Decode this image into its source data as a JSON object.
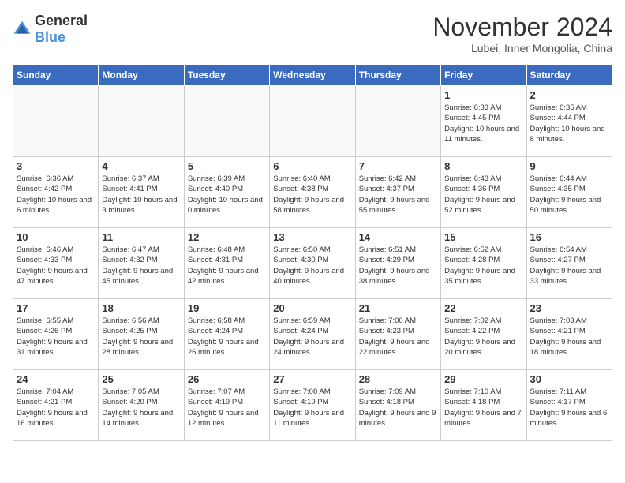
{
  "header": {
    "logo_general": "General",
    "logo_blue": "Blue",
    "month_title": "November 2024",
    "location": "Lubei, Inner Mongolia, China"
  },
  "weekdays": [
    "Sunday",
    "Monday",
    "Tuesday",
    "Wednesday",
    "Thursday",
    "Friday",
    "Saturday"
  ],
  "weeks": [
    [
      {
        "day": "",
        "info": ""
      },
      {
        "day": "",
        "info": ""
      },
      {
        "day": "",
        "info": ""
      },
      {
        "day": "",
        "info": ""
      },
      {
        "day": "",
        "info": ""
      },
      {
        "day": "1",
        "info": "Sunrise: 6:33 AM\nSunset: 4:45 PM\nDaylight: 10 hours and 11 minutes."
      },
      {
        "day": "2",
        "info": "Sunrise: 6:35 AM\nSunset: 4:44 PM\nDaylight: 10 hours and 8 minutes."
      }
    ],
    [
      {
        "day": "3",
        "info": "Sunrise: 6:36 AM\nSunset: 4:42 PM\nDaylight: 10 hours and 6 minutes."
      },
      {
        "day": "4",
        "info": "Sunrise: 6:37 AM\nSunset: 4:41 PM\nDaylight: 10 hours and 3 minutes."
      },
      {
        "day": "5",
        "info": "Sunrise: 6:39 AM\nSunset: 4:40 PM\nDaylight: 10 hours and 0 minutes."
      },
      {
        "day": "6",
        "info": "Sunrise: 6:40 AM\nSunset: 4:38 PM\nDaylight: 9 hours and 58 minutes."
      },
      {
        "day": "7",
        "info": "Sunrise: 6:42 AM\nSunset: 4:37 PM\nDaylight: 9 hours and 55 minutes."
      },
      {
        "day": "8",
        "info": "Sunrise: 6:43 AM\nSunset: 4:36 PM\nDaylight: 9 hours and 52 minutes."
      },
      {
        "day": "9",
        "info": "Sunrise: 6:44 AM\nSunset: 4:35 PM\nDaylight: 9 hours and 50 minutes."
      }
    ],
    [
      {
        "day": "10",
        "info": "Sunrise: 6:46 AM\nSunset: 4:33 PM\nDaylight: 9 hours and 47 minutes."
      },
      {
        "day": "11",
        "info": "Sunrise: 6:47 AM\nSunset: 4:32 PM\nDaylight: 9 hours and 45 minutes."
      },
      {
        "day": "12",
        "info": "Sunrise: 6:48 AM\nSunset: 4:31 PM\nDaylight: 9 hours and 42 minutes."
      },
      {
        "day": "13",
        "info": "Sunrise: 6:50 AM\nSunset: 4:30 PM\nDaylight: 9 hours and 40 minutes."
      },
      {
        "day": "14",
        "info": "Sunrise: 6:51 AM\nSunset: 4:29 PM\nDaylight: 9 hours and 38 minutes."
      },
      {
        "day": "15",
        "info": "Sunrise: 6:52 AM\nSunset: 4:28 PM\nDaylight: 9 hours and 35 minutes."
      },
      {
        "day": "16",
        "info": "Sunrise: 6:54 AM\nSunset: 4:27 PM\nDaylight: 9 hours and 33 minutes."
      }
    ],
    [
      {
        "day": "17",
        "info": "Sunrise: 6:55 AM\nSunset: 4:26 PM\nDaylight: 9 hours and 31 minutes."
      },
      {
        "day": "18",
        "info": "Sunrise: 6:56 AM\nSunset: 4:25 PM\nDaylight: 9 hours and 28 minutes."
      },
      {
        "day": "19",
        "info": "Sunrise: 6:58 AM\nSunset: 4:24 PM\nDaylight: 9 hours and 26 minutes."
      },
      {
        "day": "20",
        "info": "Sunrise: 6:59 AM\nSunset: 4:24 PM\nDaylight: 9 hours and 24 minutes."
      },
      {
        "day": "21",
        "info": "Sunrise: 7:00 AM\nSunset: 4:23 PM\nDaylight: 9 hours and 22 minutes."
      },
      {
        "day": "22",
        "info": "Sunrise: 7:02 AM\nSunset: 4:22 PM\nDaylight: 9 hours and 20 minutes."
      },
      {
        "day": "23",
        "info": "Sunrise: 7:03 AM\nSunset: 4:21 PM\nDaylight: 9 hours and 18 minutes."
      }
    ],
    [
      {
        "day": "24",
        "info": "Sunrise: 7:04 AM\nSunset: 4:21 PM\nDaylight: 9 hours and 16 minutes."
      },
      {
        "day": "25",
        "info": "Sunrise: 7:05 AM\nSunset: 4:20 PM\nDaylight: 9 hours and 14 minutes."
      },
      {
        "day": "26",
        "info": "Sunrise: 7:07 AM\nSunset: 4:19 PM\nDaylight: 9 hours and 12 minutes."
      },
      {
        "day": "27",
        "info": "Sunrise: 7:08 AM\nSunset: 4:19 PM\nDaylight: 9 hours and 11 minutes."
      },
      {
        "day": "28",
        "info": "Sunrise: 7:09 AM\nSunset: 4:18 PM\nDaylight: 9 hours and 9 minutes."
      },
      {
        "day": "29",
        "info": "Sunrise: 7:10 AM\nSunset: 4:18 PM\nDaylight: 9 hours and 7 minutes."
      },
      {
        "day": "30",
        "info": "Sunrise: 7:11 AM\nSunset: 4:17 PM\nDaylight: 9 hours and 6 minutes."
      }
    ]
  ]
}
